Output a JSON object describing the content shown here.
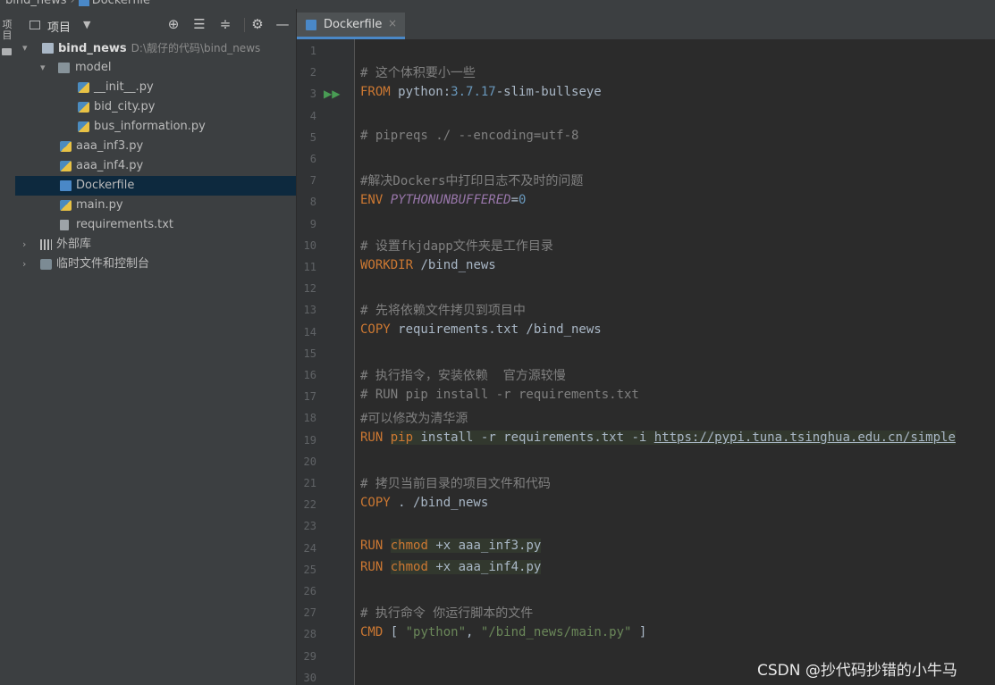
{
  "breadcrumb": {
    "project": "bind_news",
    "file": "Dockerfile"
  },
  "left_stripe": {
    "label": "项目"
  },
  "project_panel": {
    "title": "项目",
    "toolbar": [
      "locate",
      "expand",
      "collapse",
      "settings",
      "hide"
    ],
    "tree": [
      {
        "label": "bind_news",
        "path": "D:\\靓仔的代码\\bind_news",
        "icon": "folder-icon",
        "expanded": true,
        "bold": true
      },
      {
        "label": "model",
        "icon": "package-icon",
        "expanded": true
      },
      {
        "label": "__init__.py",
        "icon": "python-file-icon"
      },
      {
        "label": "bid_city.py",
        "icon": "python-file-icon"
      },
      {
        "label": "bus_information.py",
        "icon": "python-file-icon"
      },
      {
        "label": "aaa_inf3.py",
        "icon": "python-file-icon"
      },
      {
        "label": "aaa_inf4.py",
        "icon": "python-file-icon"
      },
      {
        "label": "Dockerfile",
        "icon": "docker-file-icon",
        "selected": true
      },
      {
        "label": "main.py",
        "icon": "python-file-icon"
      },
      {
        "label": "requirements.txt",
        "icon": "text-file-icon"
      },
      {
        "label": "外部库",
        "icon": "library-icon",
        "expanded": false
      },
      {
        "label": "临时文件和控制台",
        "icon": "scratch-icon",
        "expanded": false
      }
    ]
  },
  "editor": {
    "tab": {
      "label": "Dockerfile",
      "close": "×"
    },
    "line_numbers": [
      "1",
      "2",
      "3",
      "4",
      "5",
      "6",
      "7",
      "8",
      "9",
      "10",
      "11",
      "12",
      "13",
      "14",
      "15",
      "16",
      "17",
      "18",
      "19",
      "20",
      "21",
      "22",
      "23",
      "24",
      "25",
      "26",
      "27",
      "28",
      "29",
      "30"
    ],
    "lines": {
      "l2": {
        "c": "# 这个体积要小一些"
      },
      "l3": {
        "kw": "FROM",
        "a": " python:",
        "num": "3.7.17",
        "b": "-slim-bullseye"
      },
      "l5": {
        "c": "# pipreqs ./ --encoding=utf-8"
      },
      "l7": {
        "c": "#解决Dockers中打印日志不及时的问题"
      },
      "l8": {
        "kw": "ENV",
        "env": "PYTHONUNBUFFERED",
        "eq": "=",
        "num": "0"
      },
      "l10": {
        "c": "# 设置fkjdapp文件夹是工作目录"
      },
      "l11": {
        "kw": "WORKDIR",
        "a": " /bind_news"
      },
      "l13": {
        "c": "# 先将依赖文件拷贝到项目中"
      },
      "l14": {
        "kw": "COPY",
        "a": " requirements.txt /bind_news"
      },
      "l16": {
        "c": "# 执行指令，安装依赖  官方源较慢"
      },
      "l17": {
        "c": "# RUN pip install -r requirements.txt"
      },
      "l18": {
        "c": "#可以修改为清华源"
      },
      "l19": {
        "kw": "RUN",
        "kw2": "pip",
        "a": " install -r requirements.txt -i ",
        "url": "https://pypi.tuna.tsinghua.edu.cn/simple"
      },
      "l21": {
        "c": "# 拷贝当前目录的项目文件和代码"
      },
      "l22": {
        "kw": "COPY",
        "a": " . /bind_news"
      },
      "l24": {
        "kw": "RUN",
        "kw2": "chmod",
        "a": " +x aaa_inf3.py"
      },
      "l25": {
        "kw": "RUN",
        "kw2": "chmod",
        "a": " +x aaa_inf4.py"
      },
      "l27": {
        "c": "# 执行命令 你运行脚本的文件"
      },
      "l28": {
        "kw": "CMD",
        "a": " [ ",
        "s1": "\"python\"",
        "comma": ", ",
        "s2": "\"/bind_news/main.py\"",
        "b": " ]"
      }
    }
  },
  "watermark": "CSDN @抄代码抄错的小牛马",
  "colors": {
    "keyword": "#cc7832",
    "comment": "#808080",
    "number": "#6897bb",
    "string": "#6a8759",
    "env": "#9876aa",
    "selection": "#0d293e",
    "tab_accent": "#4a88c7"
  }
}
